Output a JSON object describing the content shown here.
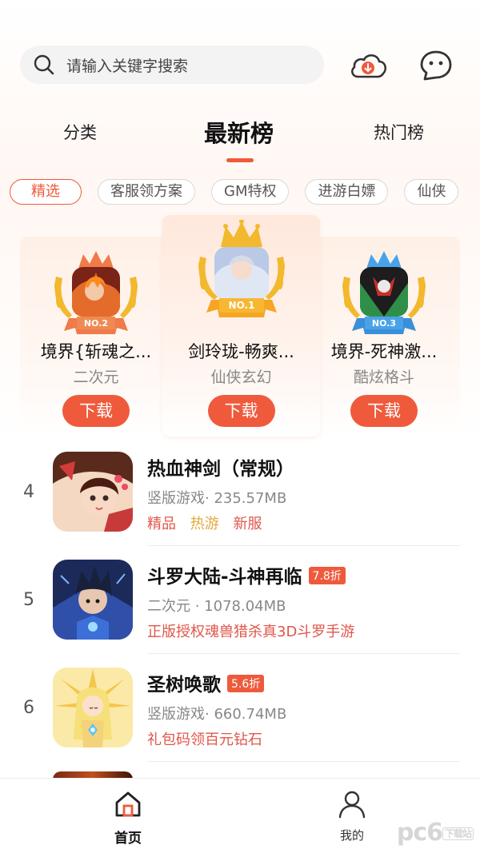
{
  "header": {
    "search_placeholder": "请输入关键字搜索",
    "download_icon": "download-cloud-icon",
    "message_icon": "message-bubble-icon"
  },
  "tabs": {
    "category": "分类",
    "newest": "最新榜",
    "hot": "热门榜",
    "active": "最新榜"
  },
  "chips": [
    "精选",
    "客服领方案",
    "GM特权",
    "进游白嫖",
    "仙侠"
  ],
  "podium": {
    "first": {
      "rank": "NO.1",
      "name": "剑玲珑-畅爽...",
      "genre": "仙侠玄幻",
      "button": "下载"
    },
    "second": {
      "rank": "NO.2",
      "name": "境界{斩魂之...",
      "genre": "二次元",
      "button": "下载"
    },
    "third": {
      "rank": "NO.3",
      "name": "境界-死神激...",
      "genre": "酷炫格斗",
      "button": "下载"
    }
  },
  "list": [
    {
      "rank": "4",
      "title": "热血神剑（常规）",
      "meta": "竖版游戏· 235.57MB",
      "tags": [
        "精品",
        "热游",
        "新服"
      ]
    },
    {
      "rank": "5",
      "title": "斗罗大陆-斗神再临",
      "discount": "7.8折",
      "meta": "二次元 · 1078.04MB",
      "desc": "正版授权魂兽猎杀真3D斗罗手游"
    },
    {
      "rank": "6",
      "title": "圣树唤歌",
      "discount": "5.6折",
      "meta": "竖版游戏· 660.74MB",
      "desc": "礼包码领百元钻石"
    }
  ],
  "bottom_nav": {
    "home": "首页",
    "mine": "我的"
  },
  "watermark": {
    "text": "pc6",
    "badge": "下载站"
  },
  "colors": {
    "accent": "#ef5a3c",
    "tag_red": "#e0574a",
    "tag_gold": "#e2a93b",
    "gold": "#f2b92f",
    "silver_ribbon": "#ef8a52",
    "blue_ribbon": "#4aa3e8"
  }
}
